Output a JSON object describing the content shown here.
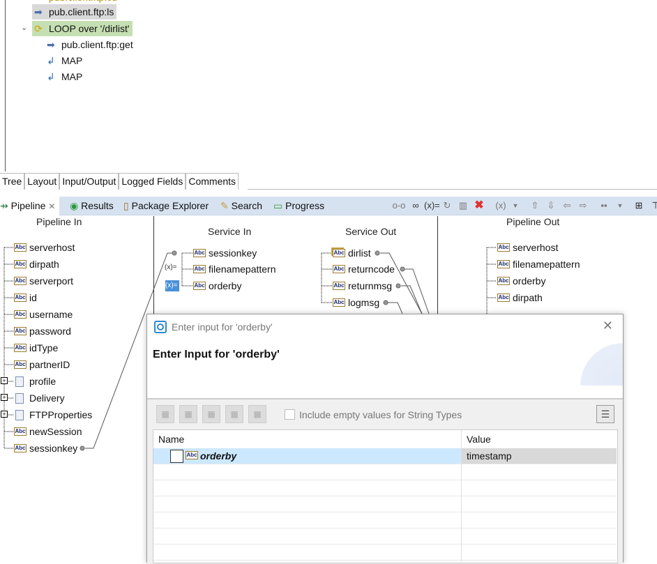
{
  "flow_tree": {
    "items": [
      {
        "label": "pub.client.ftp:ls",
        "icon": "invoke-arrow-icon",
        "state": "selected"
      },
      {
        "label": "LOOP over '/dirlist'",
        "icon": "loop-icon",
        "state": "highlighted"
      },
      {
        "label": "pub.client.ftp:get",
        "icon": "invoke-arrow-icon"
      },
      {
        "label": "MAP",
        "icon": "map-icon"
      },
      {
        "label": "MAP",
        "icon": "map-icon"
      }
    ]
  },
  "editor_tabs": [
    "Tree",
    "Layout",
    "Input/Output",
    "Logged Fields",
    "Comments"
  ],
  "view_tabs": [
    {
      "label": "Pipeline",
      "icon": "pipeline-icon",
      "active": true
    },
    {
      "label": "Results",
      "icon": "results-icon"
    },
    {
      "label": "Package Explorer",
      "icon": "package-icon"
    },
    {
      "label": "Search",
      "icon": "search-icon"
    },
    {
      "label": "Progress",
      "icon": "progress-icon"
    }
  ],
  "pipeline": {
    "in_title": "Pipeline In",
    "service_in_title": "Service In",
    "service_out_title": "Service Out",
    "out_title": "Pipeline Out",
    "pipeline_in": [
      "serverhost",
      "dirpath",
      "serverport",
      "id",
      "username",
      "password",
      "idType",
      "partnerID",
      "profile",
      "Delivery",
      "FTPProperties",
      "newSession",
      "sessionkey"
    ],
    "service_in": [
      "sessionkey",
      "filenamepattern",
      "orderby"
    ],
    "service_out": [
      "dirlist",
      "returncode",
      "returnmsg",
      "logmsg"
    ],
    "pipeline_out": [
      "serverhost",
      "filenamepattern",
      "orderby",
      "dirpath"
    ]
  },
  "dialog": {
    "title": "Enter input for 'orderby'",
    "heading": "Enter Input for 'orderby'",
    "checkbox_label": "Include empty values for String Types",
    "checkbox_checked": false,
    "columns": [
      "Name",
      "Value"
    ],
    "rows": [
      {
        "name": "orderby",
        "value": "timestamp"
      }
    ]
  }
}
